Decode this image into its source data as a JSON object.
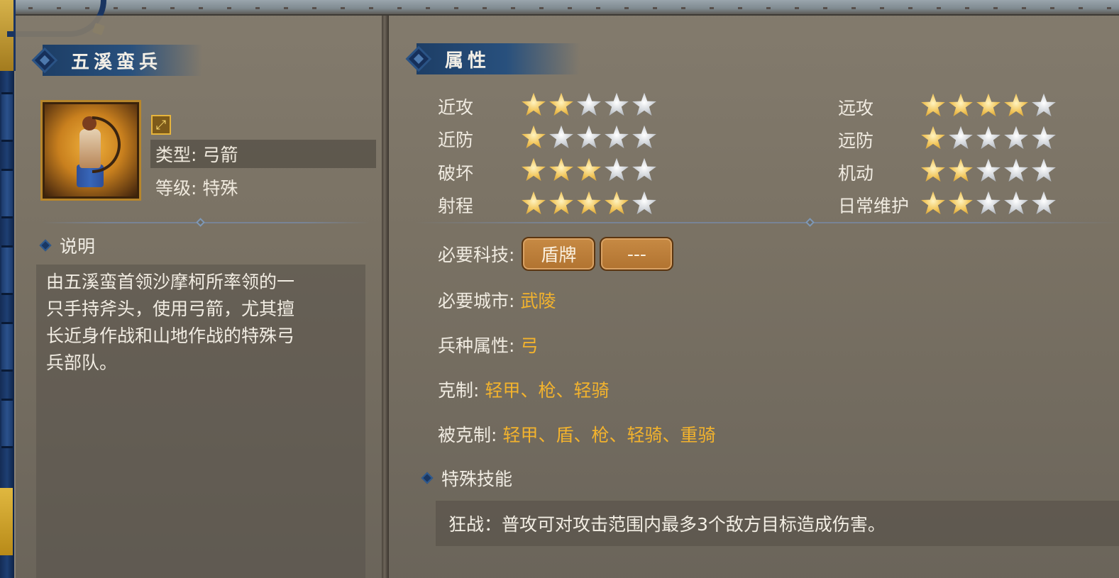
{
  "unit": {
    "name": "五溪蛮兵",
    "type_label": "类型: 弓箭",
    "grade_label": "等级: 特殊",
    "class_icon": "bow-icon",
    "portrait": "archer-unit-portrait"
  },
  "description": {
    "heading": "说明",
    "lines": [
      "由五溪蛮首领沙摩柯所率领的一",
      "只手持斧头，使用弓箭，尤其擅",
      "长近身作战和山地作战的特殊弓",
      "兵部队。"
    ]
  },
  "attributes": {
    "heading": "属性",
    "left": [
      {
        "label": "近攻",
        "stars": 2
      },
      {
        "label": "近防",
        "stars": 1
      },
      {
        "label": "破坏",
        "stars": 3
      },
      {
        "label": "射程",
        "stars": 4
      }
    ],
    "right": [
      {
        "label": "远攻",
        "stars": 4
      },
      {
        "label": "远防",
        "stars": 1
      },
      {
        "label": "机动",
        "stars": 2
      },
      {
        "label": "日常维护",
        "stars": 2
      }
    ],
    "max_stars": 5
  },
  "requirements": {
    "tech_label": "必要科技:",
    "tech_buttons": [
      "盾牌",
      "---"
    ],
    "city_label": "必要城市:",
    "city_value": "武陵",
    "troop_label": "兵种属性:",
    "troop_value": "弓",
    "counters_label": "克制:",
    "counters_value": "轻甲、枪、轻骑",
    "countered_by_label": "被克制:",
    "countered_by_value": "轻甲、盾、枪、轻骑、重骑"
  },
  "skills": {
    "heading": "特殊技能",
    "text": "狂战：普攻可对攻击范围内最多3个敌方目标造成伤害。"
  },
  "colors": {
    "accent_value": "#f3b32d",
    "banner_blue": "#1d3e66",
    "button_orange": "#c78a44"
  }
}
